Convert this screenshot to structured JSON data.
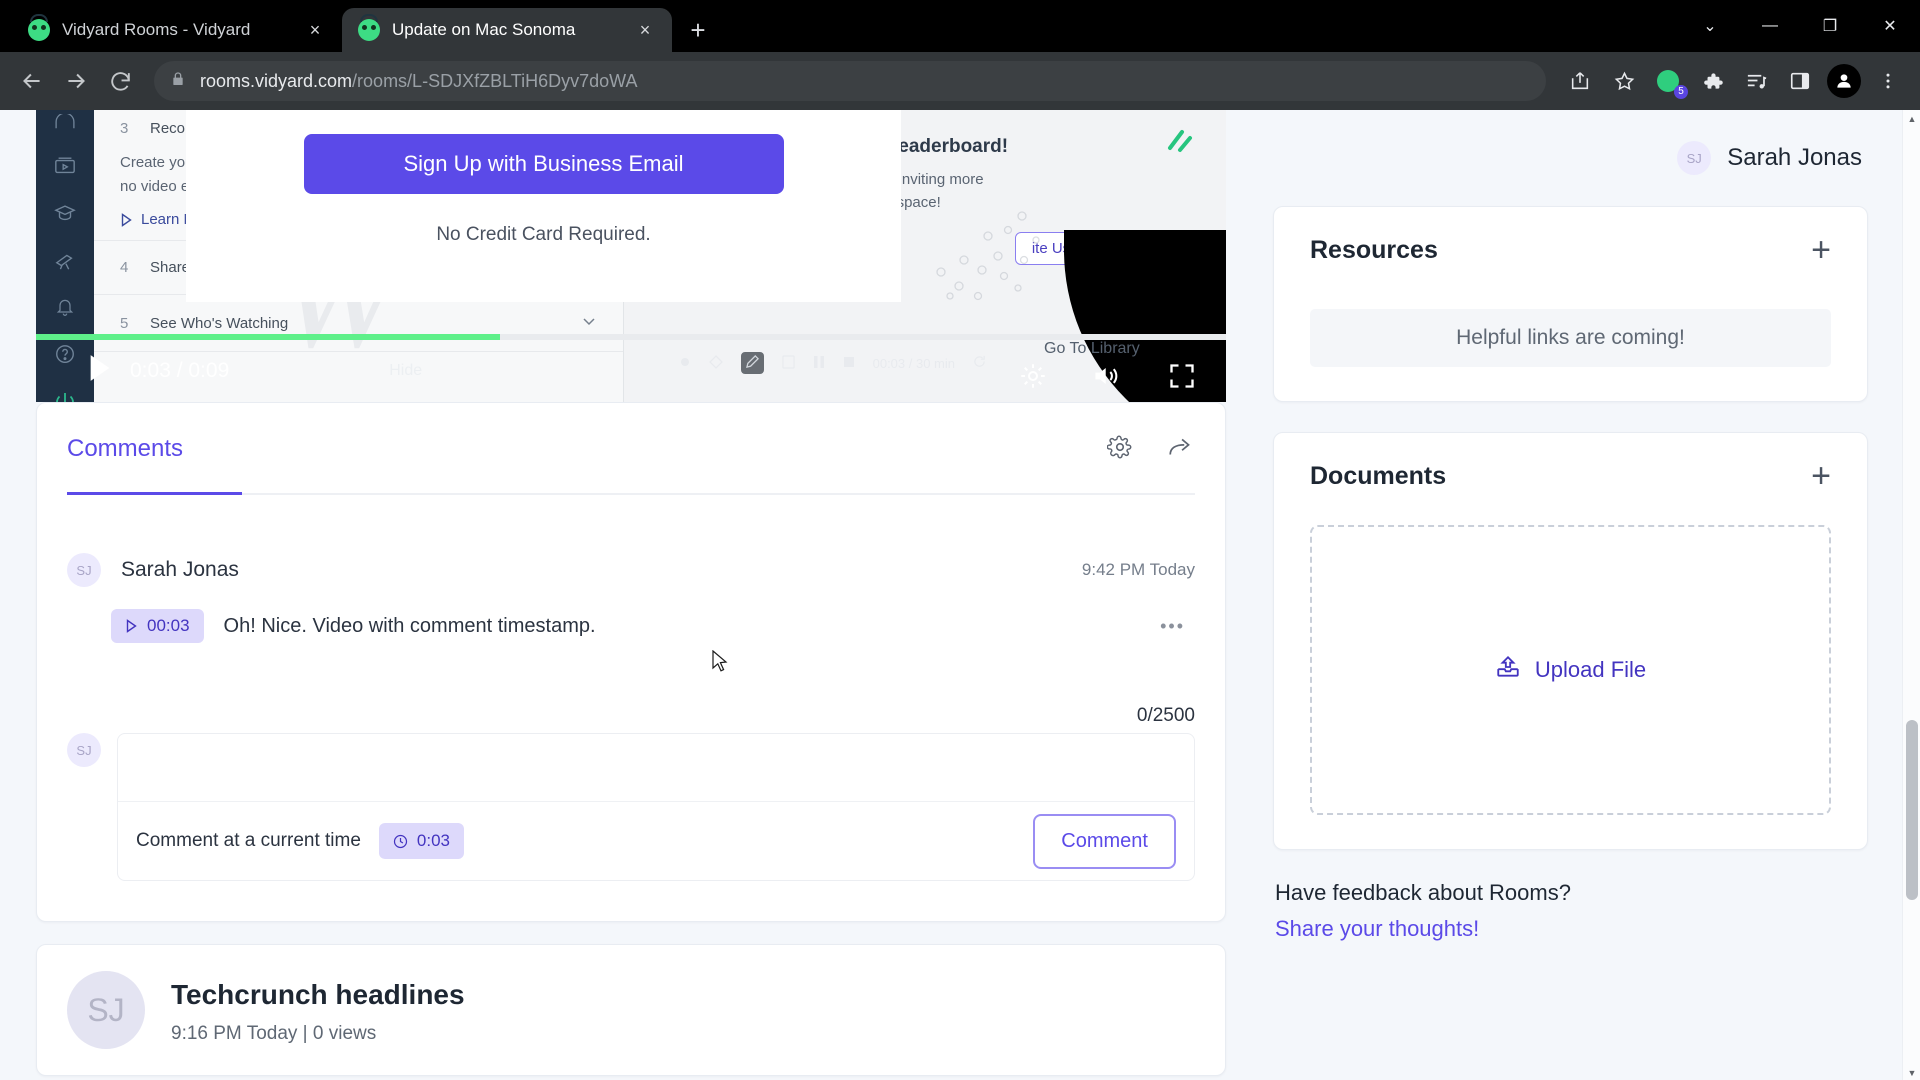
{
  "browser": {
    "tabs": [
      {
        "title": "Vidyard Rooms - Vidyard",
        "close_label": "×",
        "active": false
      },
      {
        "title": "Update on Mac Sonoma",
        "close_label": "×",
        "active": true
      }
    ],
    "new_tab_label": "+",
    "window_controls": {
      "more": "⌄",
      "minimize": "—",
      "maximize": "❐",
      "close": "✕"
    },
    "nav": {
      "back": "←",
      "forward": "→",
      "reload": "↻"
    },
    "omnibox": {
      "lock_icon": "lock-icon",
      "url_domain": "rooms.vidyard.com",
      "url_path": "/rooms/L-SDJXfZBLTiH6Dyv7doWA"
    },
    "toolbar_icons": [
      {
        "name": "share-icon"
      },
      {
        "name": "bookmark-star-icon"
      },
      {
        "name": "vidyard-extension-icon",
        "badge": "5"
      },
      {
        "name": "extensions-puzzle-icon"
      },
      {
        "name": "media-playlist-icon"
      },
      {
        "name": "side-panel-icon"
      },
      {
        "name": "profile-avatar-icon"
      },
      {
        "name": "browser-menu-icon"
      }
    ]
  },
  "player": {
    "steps": [
      {
        "num": "3",
        "label": "Record a Video"
      },
      {
        "num": "4",
        "label": "Share Your Video"
      },
      {
        "num": "5",
        "label": "See Who's Watching"
      }
    ],
    "step3_body_line1": "Create your own videos",
    "step3_body_line2": "no video expertise requi",
    "learn_more": "Learn More",
    "leaderboard_headline": "th the leaderboard!",
    "leaderboard_sub_line1": "board by inviting more",
    "leaderboard_sub_line2": "our Workspace!",
    "invite_users": "ite Users",
    "signup_button": "Sign Up with Business Email",
    "signup_note": "No Credit Card Required.",
    "go_to_library": "Go To Library",
    "hide_label": "Hide",
    "current_time": "0:03",
    "duration": "0:09",
    "time_display": "0:03 / 0:09",
    "mini_time_display": "00:03 / 30 min",
    "progress_percent": 39
  },
  "comments": {
    "tab_label": "Comments",
    "settings_icon": "gear-icon",
    "share_icon": "share-icon",
    "items": [
      {
        "avatar_initials": "SJ",
        "author": "Sarah Jonas",
        "timestamp": "9:42 PM Today",
        "video_time": "00:03",
        "text": "Oh! Nice. Video with comment timestamp.",
        "more_label": "•••"
      }
    ],
    "char_count": "0/2500",
    "composer": {
      "avatar_initials": "SJ",
      "value": "",
      "placeholder": "",
      "time_label": "Comment at a current time",
      "time_chip": "0:03",
      "submit_label": "Comment"
    }
  },
  "video_item": {
    "avatar_initials": "SJ",
    "title": "Techcrunch headlines",
    "meta": "9:16 PM Today  |  0 views"
  },
  "sidebar": {
    "user": {
      "initials": "SJ",
      "name": "Sarah Jonas"
    },
    "resources": {
      "title": "Resources",
      "add_label": "+",
      "empty_text": "Helpful links are coming!"
    },
    "documents": {
      "title": "Documents",
      "add_label": "+",
      "upload_label": "Upload File"
    },
    "feedback": {
      "question": "Have feedback about Rooms?",
      "link": "Share your thoughts!"
    }
  },
  "colors": {
    "accent": "#5b4ae8",
    "chip_bg": "#ddd9fb",
    "page_bg": "#f4f7fb",
    "chrome_bg": "#323639",
    "progress_green": "#5ef08a"
  }
}
